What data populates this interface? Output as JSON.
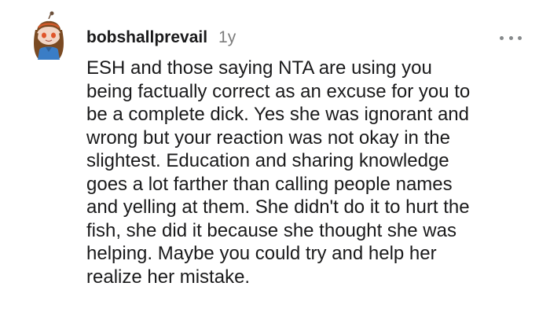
{
  "comment": {
    "username": "bobshallprevail",
    "age": "1y",
    "more_icon": "more-horizontal-icon",
    "avatar_icon": "snoo-avatar-icon",
    "body_lines": [
      "ESH and those saying NTA are using you",
      "being factually correct as an excuse for you to",
      "be a complete dick. Yes she was ignorant and",
      "wrong but your reaction was not okay in the",
      "slightest. Education and sharing knowledge",
      "goes a lot farther than calling people names",
      "and yelling at them. She didn't do it to hurt the",
      "fish, she did it because she thought she was",
      "helping. Maybe you could try and help her",
      "realize her mistake."
    ]
  },
  "colors": {
    "text": "#1a1a1b",
    "muted": "#7c7c7c",
    "icon_gray": "#878a8c"
  }
}
